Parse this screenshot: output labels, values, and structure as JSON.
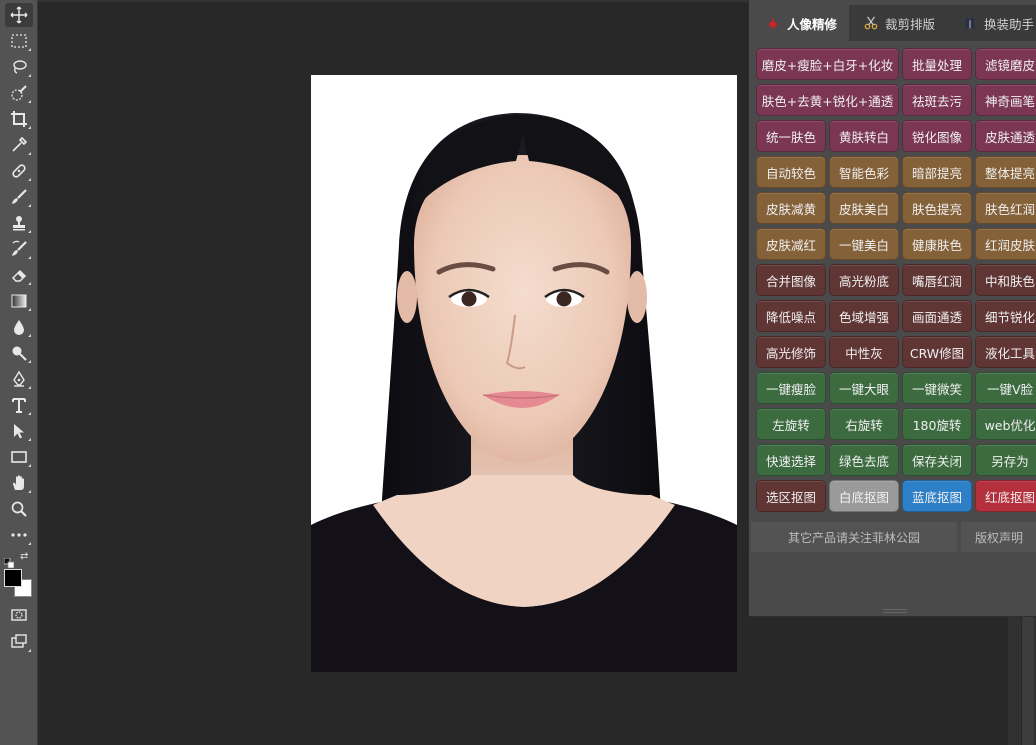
{
  "panel": {
    "tabs": [
      {
        "label": "人像精修",
        "icon": "person-brush-icon"
      },
      {
        "label": "裁剪排版",
        "icon": "scissors-icon"
      },
      {
        "label": "换装助手",
        "icon": "suit-icon"
      }
    ],
    "rows": [
      [
        {
          "label": "磨皮+瘦脸+白牙+化妆",
          "color": "pink"
        },
        {
          "label": "批量处理",
          "color": "pink"
        },
        {
          "label": "滤镜磨皮",
          "color": "pink"
        }
      ],
      [
        {
          "label": "肤色+去黄+锐化+通透",
          "color": "pink"
        },
        {
          "label": "祛斑去污",
          "color": "pink"
        },
        {
          "label": "神奇画笔",
          "color": "pink"
        }
      ],
      [
        {
          "label": "统一肤色",
          "color": "pink"
        },
        {
          "label": "黄肤转白",
          "color": "pink"
        },
        {
          "label": "锐化图像",
          "color": "pink"
        },
        {
          "label": "皮肤通透",
          "color": "pink"
        }
      ],
      [
        {
          "label": "自动较色",
          "color": "gold"
        },
        {
          "label": "智能色彩",
          "color": "gold"
        },
        {
          "label": "暗部提亮",
          "color": "gold"
        },
        {
          "label": "整体提亮",
          "color": "gold"
        }
      ],
      [
        {
          "label": "皮肤减黄",
          "color": "gold"
        },
        {
          "label": "皮肤美白",
          "color": "gold"
        },
        {
          "label": "肤色提亮",
          "color": "gold"
        },
        {
          "label": "肤色红润",
          "color": "gold"
        }
      ],
      [
        {
          "label": "皮肤减红",
          "color": "gold"
        },
        {
          "label": "一键美白",
          "color": "gold"
        },
        {
          "label": "健康肤色",
          "color": "gold"
        },
        {
          "label": "红润皮肤",
          "color": "gold"
        }
      ],
      [
        {
          "label": "合并图像",
          "color": "maroon"
        },
        {
          "label": "高光粉底",
          "color": "maroon"
        },
        {
          "label": "嘴唇红润",
          "color": "maroon"
        },
        {
          "label": "中和肤色",
          "color": "maroon"
        }
      ],
      [
        {
          "label": "降低噪点",
          "color": "maroon"
        },
        {
          "label": "色域增强",
          "color": "maroon"
        },
        {
          "label": "画面通透",
          "color": "maroon"
        },
        {
          "label": "细节锐化",
          "color": "maroon"
        }
      ],
      [
        {
          "label": "高光修饰",
          "color": "maroon"
        },
        {
          "label": "中性灰",
          "color": "maroon"
        },
        {
          "label": "CRW修图",
          "color": "maroon"
        },
        {
          "label": "液化工具",
          "color": "maroon"
        }
      ],
      [
        {
          "label": "一键瘦脸",
          "color": "green"
        },
        {
          "label": "一键大眼",
          "color": "green"
        },
        {
          "label": "一键微笑",
          "color": "green"
        },
        {
          "label": "一键V脸",
          "color": "green"
        }
      ],
      [
        {
          "label": "左旋转",
          "color": "green"
        },
        {
          "label": "右旋转",
          "color": "green"
        },
        {
          "label": "180旋转",
          "color": "green"
        },
        {
          "label": "web优化",
          "color": "green"
        }
      ],
      [
        {
          "label": "快速选择",
          "color": "green"
        },
        {
          "label": "绿色去底",
          "color": "green"
        },
        {
          "label": "保存关闭",
          "color": "green"
        },
        {
          "label": "另存为",
          "color": "green"
        }
      ],
      [
        {
          "label": "选区抠图",
          "color": "maroon"
        },
        {
          "label": "白底抠图",
          "color": "white"
        },
        {
          "label": "蓝底抠图",
          "color": "blue"
        },
        {
          "label": "红底抠图",
          "color": "red"
        }
      ]
    ],
    "footer": {
      "left": "其它产品请关注菲林公园",
      "right": "版权声明"
    }
  },
  "toolbar": {
    "tools": [
      {
        "name": "move-tool-icon"
      },
      {
        "name": "marquee-tool-icon"
      },
      {
        "name": "lasso-tool-icon"
      },
      {
        "name": "quick-selection-tool-icon"
      },
      {
        "name": "crop-tool-icon"
      },
      {
        "name": "eyedropper-tool-icon"
      },
      {
        "name": "healing-brush-tool-icon"
      },
      {
        "name": "brush-tool-icon"
      },
      {
        "name": "clone-stamp-tool-icon"
      },
      {
        "name": "history-brush-tool-icon"
      },
      {
        "name": "eraser-tool-icon"
      },
      {
        "name": "gradient-tool-icon"
      },
      {
        "name": "blur-tool-icon"
      },
      {
        "name": "dodge-tool-icon"
      },
      {
        "name": "pen-tool-icon"
      },
      {
        "name": "type-tool-icon"
      },
      {
        "name": "path-selection-tool-icon"
      },
      {
        "name": "rectangle-tool-icon"
      },
      {
        "name": "hand-tool-icon"
      },
      {
        "name": "zoom-tool-icon"
      },
      {
        "name": "more-tools-icon"
      }
    ],
    "foreground_color": "#000000",
    "background_color": "#ffffff"
  },
  "colors": {
    "pink": "#7b3654",
    "gold": "#846139",
    "maroon": "#603635",
    "green": "#3c6b40",
    "white": "#9a9a9a",
    "blue": "#2d7fc7",
    "red": "#b4303d"
  }
}
